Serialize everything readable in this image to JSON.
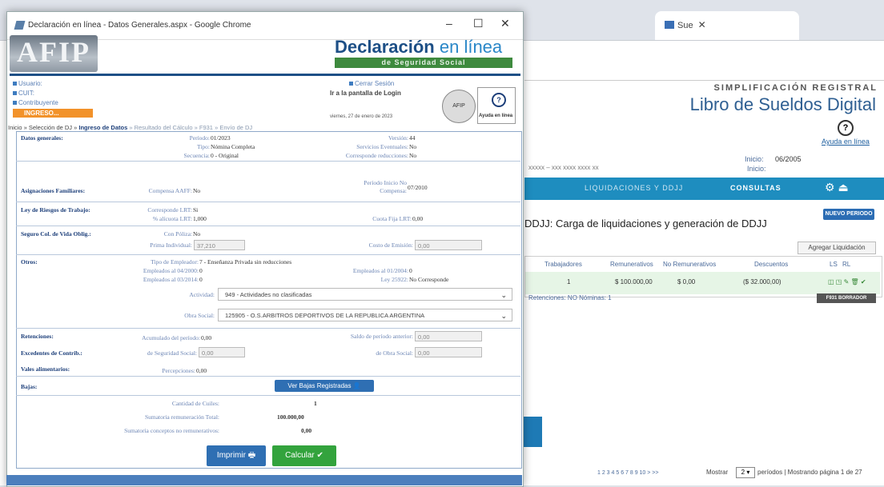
{
  "background_window": {
    "tab": {
      "title": "Sue"
    },
    "header": {
      "superscript": "SIMPLIFICACIÓN REGISTRAL",
      "title": "Libro de Sueldos Digital",
      "help_label": "Ayuda en línea"
    },
    "inicio_label_1": "Inicio:",
    "inicio_value_1": "06/2005",
    "inicio_label_2": "Inicio:",
    "user_line": "xxxxx – xxx xxxx xxxx xx",
    "nav": {
      "liquidaciones": "LIQUIDACIONES Y DDJJ",
      "consultas": "CONSULTAS",
      "icons": "⚙ ⏏"
    },
    "page_title": "DDJJ: Carga de liquidaciones y generación de DDJJ",
    "nuevo_periodo": "NUEVO PERIODO",
    "agregar_liquidacion": "Agregar Liquidación",
    "table": {
      "headers": [
        "Trabajadores",
        "Remunerativos",
        "No Remunerativos",
        "Descuentos",
        "LS",
        "RL"
      ],
      "row": [
        "1",
        "$ 100.000,00",
        "$ 0,00",
        "($ 32.000,00)"
      ],
      "actions": "◫ ◳ ✎ 🗑 ✔"
    },
    "retenciones_line": "Retenciones: NO   Nóminas: 1",
    "ver_borrador": "F931 BORRADOR",
    "pagination": "1 2 3 4 5 6 7 8 9 10  >  >>",
    "mostrar_label": "Mostrar",
    "mostrar_value": "2 ▾",
    "mostrar_suffix": "períodos  |  Mostrando página 1 de 27"
  },
  "popup": {
    "window_title": "Declaración en línea - Datos Generales.aspx - Google Chrome",
    "controls": {
      "minimize": "–",
      "maximize": "☐",
      "close": "✕"
    },
    "logo_text": "AFIP",
    "brand_title": "Declaración",
    "brand_title_2": "en línea",
    "brand_subtitle": "de Seguridad Social",
    "user_links": [
      "Usuario:",
      "CUIT:",
      "Contribuyente"
    ],
    "ingreso_label": "INGRESO...",
    "cerrar_sesion": "Cerrar Sesión",
    "ir_login": "Ir a la pantalla de Login",
    "fecha": "viernes, 27 de enero de 2023",
    "seal_text": "AFIP",
    "ayuda_label": "Ayuda en línea",
    "ayuda_icon": "?",
    "breadcrumb_prefix": "Inicio » Selección de DJ » ",
    "breadcrumb_current": "Ingreso de Datos",
    "breadcrumb_rest": " » Resultado del Cálculo » F931 » Envío de DJ",
    "sections": {
      "datos_generales": {
        "label": "Datos generales:",
        "periodo_l": "Período:",
        "periodo_v": "01/2023",
        "version_l": "Versión:",
        "version_v": "44",
        "tipo_l": "Tipo:",
        "tipo_v": "Nómina Completa",
        "servicios_l": "Servicios Eventuales:",
        "servicios_v": "No",
        "secuencia_l": "Secuencia:",
        "secuencia_v": "0 - Original",
        "corresponde_l": "Corresponde reducciones:",
        "corresponde_v": "No"
      },
      "asignaciones": {
        "label": "Asignaciones Familiares:",
        "compensa_l": "Compensa AAFF:",
        "compensa_v": "No",
        "periodo_inicio_l": "Período Inicio No Compensa:",
        "periodo_inicio_v": "07/2010"
      },
      "riesgos": {
        "label": "Ley de Riesgos de Trabajo:",
        "corresponde_l": "Corresponde LRT:",
        "corresponde_v": "Si",
        "alicuota_l": "% alícuota LRT:",
        "alicuota_v": "1,000",
        "cuota_l": "Cuota Fija LRT:",
        "cuota_v": "0,00"
      },
      "seguro": {
        "label": "Seguro Col. de Vida Oblig.:",
        "con_poliza_l": "Con Póliza:",
        "con_poliza_v": "No",
        "prima_l": "Prima Individual:",
        "prima_v": "37,210",
        "costo_l": "Costo de Emisión:",
        "costo_v": "0,00"
      },
      "otros": {
        "label": "Otros:",
        "tipo_empleador_l": "Tipo de Empleador:",
        "tipo_empleador_v": "7 - Enseñanza Privada sin reducciones",
        "empl_0400_l": "Empleados al 04/2000:",
        "empl_0400_v": "0",
        "empl_0104_l": "Empleados al 01/2004:",
        "empl_0104_v": "0",
        "empl_0314_l": "Empleados al 03/2014:",
        "empl_0314_v": "0",
        "ley_l": "Ley 25922:",
        "ley_v": "No Corresponde",
        "actividad_l": "Actividad:",
        "actividad_v": "949 - Actividades no clasificadas",
        "obra_l": "Obra Social:",
        "obra_v": "125905 - O.S.ARBITROS DEPORTIVOS DE LA REPUBLICA ARGENTINA"
      },
      "retenciones": {
        "label": "Retenciones:",
        "acumulado_l": "Acumulado del período:",
        "acumulado_v": "0,00",
        "saldo_l": "Saldo de período anterior:",
        "saldo_v": "0,00"
      },
      "excedentes": {
        "label": "Excedentes de Contrib.:",
        "seguridad_l": "de Seguridad Social:",
        "seguridad_v": "0,00",
        "obra_l": "de Obra Social:",
        "obra_v": "0,00"
      },
      "vales": {
        "label": "Vales alimentarios:",
        "percepciones_l": "Percepciones:",
        "percepciones_v": "0,00"
      },
      "bajas": {
        "label": "Bajas:",
        "button": "Ver Bajas Registradas"
      },
      "totales": {
        "cuiles_l": "Cantidad de Cuiles:",
        "cuiles_v": "1",
        "remun_l": "Sumatoria remuneración Total:",
        "remun_v": "100.000,00",
        "no_remun_l": "Sumatoria conceptos no remunerativos:",
        "no_remun_v": "0,00"
      }
    },
    "buttons": {
      "imprimir": "Imprimir",
      "calcular": "Calcular"
    }
  }
}
